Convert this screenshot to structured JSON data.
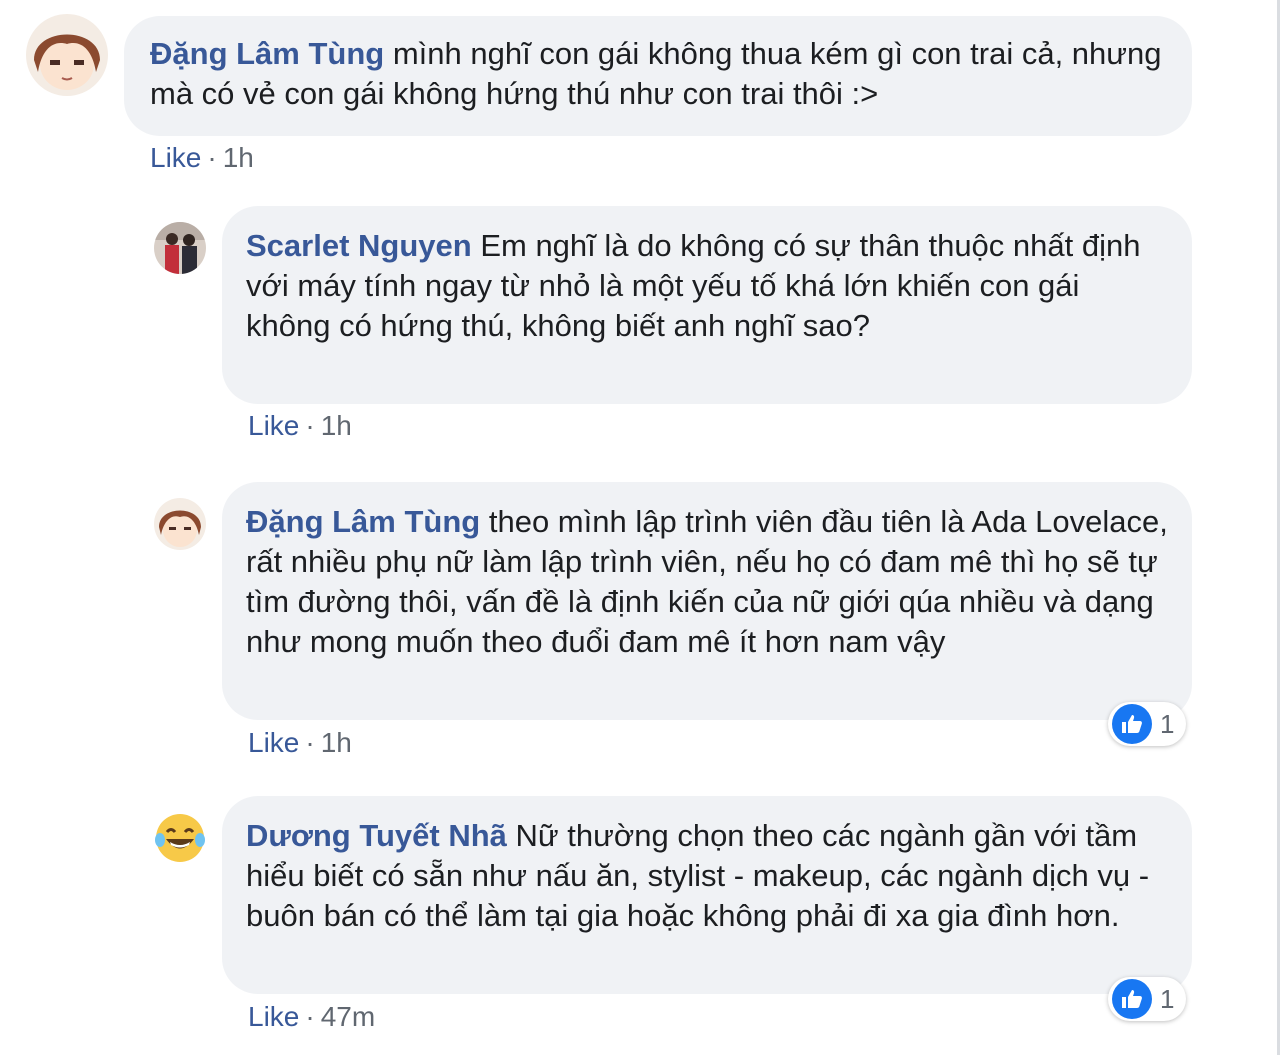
{
  "comments": [
    {
      "author": "Đặng Lâm Tùng",
      "text": "mình nghĩ con gái không thua kém gì con trai cả, nhưng mà có vẻ con gái không hứng thú như con trai thôi :>",
      "like_label": "Like",
      "separator": "·",
      "time": "1h",
      "avatar_icon": "anime-girl-avatar-icon"
    },
    {
      "author": "Scarlet Nguyen",
      "text": "Em nghĩ là do không có sự thân thuộc nhất định với máy tính ngay từ nhỏ là một yếu tố khá lớn khiến con gái không có hứng thú, không biết anh nghĩ sao?",
      "like_label": "Like",
      "separator": "·",
      "time": "1h",
      "avatar_icon": "photo-avatar-icon"
    },
    {
      "author": "Đặng Lâm Tùng",
      "text": "theo mình lập trình viên đầu tiên là Ada Lovelace, rất nhiều phụ nữ làm lập trình viên, nếu họ có đam mê thì họ sẽ tự tìm đường thôi, vấn đề là định kiến của nữ giới qúa nhiều và dạng như mong muốn theo đuổi đam mê ít hơn nam vậy",
      "like_label": "Like",
      "separator": "·",
      "time": "1h",
      "reaction_count": "1",
      "avatar_icon": "anime-girl-avatar-icon"
    },
    {
      "author": "Dương Tuyết Nhã",
      "text": "Nữ thường chọn theo các ngành gần với tầm hiểu biết có sẵn như nấu ăn, stylist - makeup, các ngành dịch vụ - buôn bán có thể làm tại gia hoặc không phải đi xa gia đình hơn.",
      "like_label": "Like",
      "separator": "·",
      "time": "47m",
      "reaction_count": "1",
      "avatar_icon": "laughing-emoji-avatar-icon"
    }
  ],
  "colors": {
    "author": "#385898",
    "bubble": "#f0f2f5",
    "meta": "#606770",
    "like_reaction": "#1877f2"
  }
}
